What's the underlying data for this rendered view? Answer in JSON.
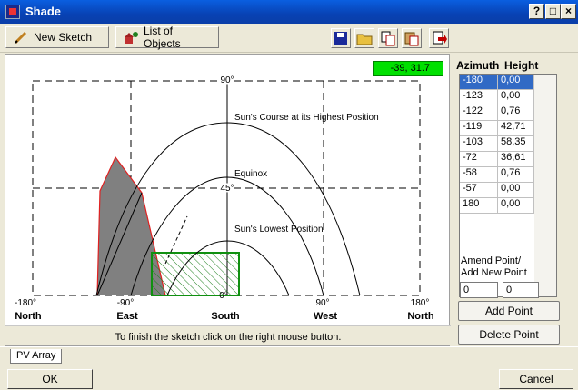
{
  "window": {
    "title": "Shade"
  },
  "toolbar": {
    "new_sketch": "New Sketch",
    "list_of_objects": "List of Objects"
  },
  "chart_data": {
    "type": "line",
    "x_ticks": [
      "-180°",
      "-90°",
      "0°",
      "90°",
      "180°"
    ],
    "x_dirs": [
      "North",
      "East",
      "South",
      "West",
      "North"
    ],
    "y_ticks": [
      "90°",
      "45°",
      "0°"
    ],
    "xlim": [
      -180,
      180
    ],
    "ylim": [
      0,
      90
    ],
    "annotations": {
      "highest": "Sun's Course at its Highest Position",
      "equinox": "Equinox",
      "lowest": "Sun's Lowest Position"
    },
    "coord_readout": "-39, 31.7"
  },
  "hint": "To finish the sketch click on the right mouse button.",
  "table": {
    "headers": [
      "Azimuth",
      "Height"
    ],
    "rows": [
      [
        "-180",
        "0,00"
      ],
      [
        "-123",
        "0,00"
      ],
      [
        "-122",
        "0,76"
      ],
      [
        "-119",
        "42,71"
      ],
      [
        "-103",
        "58,35"
      ],
      [
        "-72",
        "36,61"
      ],
      [
        "-58",
        "0,76"
      ],
      [
        "-57",
        "0,00"
      ],
      [
        "180",
        "0,00"
      ]
    ]
  },
  "amend": {
    "label1": "Amend Point/",
    "label2": "Add New Point",
    "azimuth_value": "0",
    "height_value": "0",
    "add_point": "Add Point",
    "delete_point": "Delete Point"
  },
  "tabs": {
    "pv_array": "PV Array"
  },
  "footer": {
    "ok": "OK",
    "cancel": "Cancel"
  }
}
